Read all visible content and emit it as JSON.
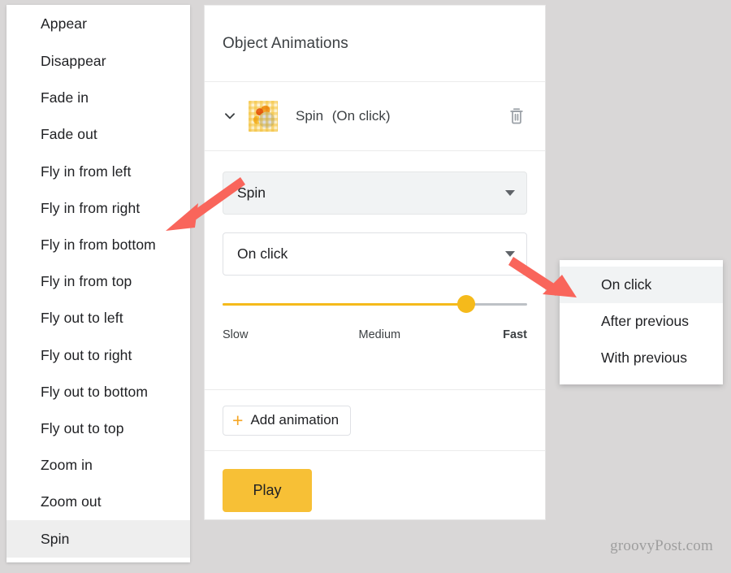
{
  "animation_list": {
    "name": "animation-type-list",
    "items": [
      {
        "label": "Appear",
        "selected": false
      },
      {
        "label": "Disappear",
        "selected": false
      },
      {
        "label": "Fade in",
        "selected": false
      },
      {
        "label": "Fade out",
        "selected": false
      },
      {
        "label": "Fly in from left",
        "selected": false
      },
      {
        "label": "Fly in from right",
        "selected": false
      },
      {
        "label": "Fly in from bottom",
        "selected": false
      },
      {
        "label": "Fly in from top",
        "selected": false
      },
      {
        "label": "Fly out to left",
        "selected": false
      },
      {
        "label": "Fly out to right",
        "selected": false
      },
      {
        "label": "Fly out to bottom",
        "selected": false
      },
      {
        "label": "Fly out to top",
        "selected": false
      },
      {
        "label": "Zoom in",
        "selected": false
      },
      {
        "label": "Zoom out",
        "selected": false
      },
      {
        "label": "Spin",
        "selected": true
      }
    ]
  },
  "panel": {
    "title": "Object Animations",
    "animation_row": {
      "chevron_icon": "chevron-down-icon",
      "thumbnail_icon": "slide-object-thumbnail",
      "effect": "Spin",
      "trigger": "(On click)",
      "delete_icon": "trash-icon"
    },
    "effect_select": {
      "value": "Spin",
      "caret_icon": "caret-down-icon"
    },
    "trigger_select": {
      "value": "On click",
      "caret_icon": "caret-down-icon"
    },
    "speed_slider": {
      "percent": 80,
      "label_slow": "Slow",
      "label_medium": "Medium",
      "label_fast": "Fast"
    },
    "add_animation": {
      "plus_icon": "plus-icon",
      "label": "Add animation"
    },
    "play_button": {
      "label": "Play"
    }
  },
  "trigger_popup": {
    "name": "trigger-options-popup",
    "items": [
      {
        "label": "On click",
        "selected": true
      },
      {
        "label": "After previous",
        "selected": false
      },
      {
        "label": "With previous",
        "selected": false
      }
    ]
  },
  "annotations": {
    "arrow_color": "#f9655b",
    "arrow_left_target": "animation-type-list",
    "arrow_right_target": "trigger-options-popup"
  },
  "watermark": {
    "text": "groovyPost.com"
  },
  "colors": {
    "accent_yellow": "#f7c036",
    "slider_yellow": "#f5ba1b",
    "plus_orange": "#f5a623",
    "arrow_red": "#f9655b",
    "page_background": "#d9d7d7",
    "highlight_gray": "#f1f3f4"
  }
}
